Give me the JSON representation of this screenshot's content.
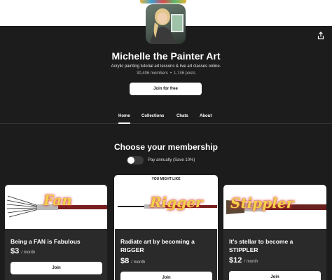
{
  "creator": {
    "name": "Michelle the Painter Art",
    "tagline": "Acrylic painting tutorial art lessons & live art classes online.",
    "members": "30,406 members",
    "posts": "1,746 posts",
    "stats_separator": "•",
    "join_free_label": "Join for free"
  },
  "tabs": [
    {
      "label": "Home",
      "active": true
    },
    {
      "label": "Collections",
      "active": false
    },
    {
      "label": "Chats",
      "active": false
    },
    {
      "label": "About",
      "active": false
    }
  ],
  "membership": {
    "title": "Choose your membership",
    "toggle_label": "Pay annually (Save 10%)",
    "toggle_on": false
  },
  "tiers": [
    {
      "banner_word": "Fan",
      "badge": "",
      "title": "Being a FAN is Fabulous",
      "price": "$3",
      "per": "/ month",
      "join_label": "Join"
    },
    {
      "banner_word": "Rigger",
      "badge": "YOU MIGHT LIKE",
      "title": "Radiate art by becoming a RIGGER",
      "price": "$8",
      "per": "/ month",
      "join_label": "Join"
    },
    {
      "banner_word": "Stippler",
      "badge": "",
      "title": "It's stellar to become a STIPPLER",
      "price": "$12",
      "per": "/ month",
      "join_label": "Join"
    }
  ],
  "icons": {
    "share": "share-icon"
  },
  "colors": {
    "page_bg": "#1c1c1c",
    "card_bg": "#2a2a2a",
    "brush_text": "#f2d14b"
  }
}
